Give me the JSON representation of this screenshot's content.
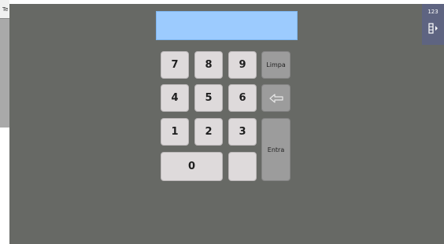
{
  "background_window": {
    "title": "Te"
  },
  "display": {
    "value": ""
  },
  "keypad": {
    "keys": {
      "k7": "7",
      "k8": "8",
      "k9": "9",
      "k4": "4",
      "k5": "5",
      "k6": "6",
      "k1": "1",
      "k2": "2",
      "k3": "3",
      "k0": "0",
      "blank": ""
    },
    "clear_label": "Limpa",
    "enter_label": "Entra",
    "backspace_icon": "left-arrow-icon"
  },
  "side_panel": {
    "mode_label": "123",
    "icon": "keyboard-switch-icon"
  },
  "colors": {
    "overlay": "#676965",
    "display": "#9ccbfe",
    "key": "#dedadb",
    "function_key": "#9c9c9c",
    "side_panel": "#5e6481"
  }
}
